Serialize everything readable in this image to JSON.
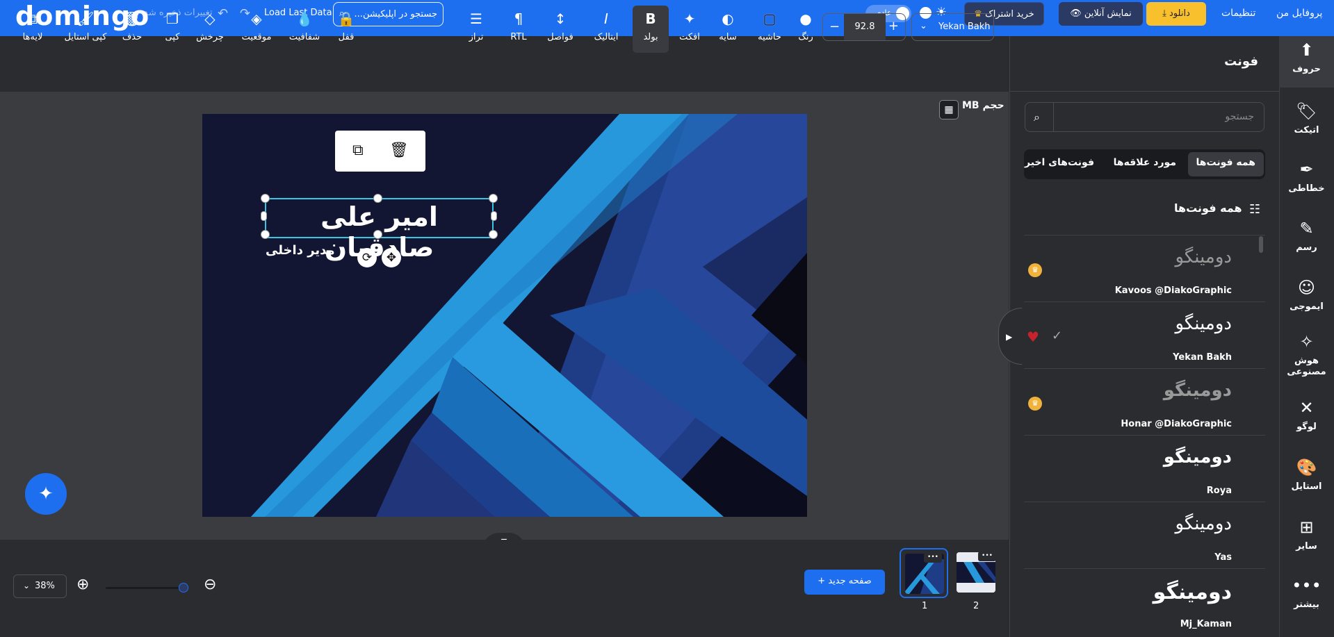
{
  "topbar": {
    "logo": "domingo",
    "saved_status": "تغییرات ذخیره شد",
    "load_last": "Load Last Data",
    "search_placeholder": "جستجو در اپلیکیشن...",
    "theme_mode": "عادی",
    "subscribe_label": "خرید اشتراک",
    "live_label": "نمایش آنلاین",
    "download_label": "دانلود",
    "settings_label": "تنظیمات",
    "profile_label": "پروفایل من",
    "brand_color": "#1e6ff0",
    "download_color": "#f8c02c"
  },
  "toolbar": {
    "font_family": "Yekan Bakh",
    "font_size": "92.8",
    "tools": [
      {
        "label": "لایه‌ها",
        "icon": "layers-icon"
      },
      {
        "label": "کپی استایل",
        "icon": "brush-icon"
      },
      {
        "label": "حذف",
        "icon": "trash-icon"
      },
      {
        "label": "کپی",
        "icon": "copy-icon"
      },
      {
        "label": "چرخش",
        "icon": "rotate-icon"
      },
      {
        "label": "موقعیت",
        "icon": "position-icon"
      },
      {
        "label": "شفافیت",
        "icon": "opacity-icon"
      },
      {
        "label": "قفل",
        "icon": "lock-icon"
      },
      {
        "label": "تراز",
        "icon": "align-icon"
      },
      {
        "label": "RTL",
        "icon": "rtl-icon"
      },
      {
        "label": "فواصل",
        "icon": "spacing-icon"
      },
      {
        "label": "ایتالیک",
        "icon": "italic-icon"
      },
      {
        "label": "بولد",
        "icon": "bold-icon"
      },
      {
        "label": "افکت",
        "icon": "effect-icon"
      },
      {
        "label": "سایه",
        "icon": "shadow-icon"
      },
      {
        "label": "حاشیه",
        "icon": "border-icon"
      },
      {
        "label": "رنگ",
        "icon": "color-icon"
      }
    ]
  },
  "canvas": {
    "file_size_label": "حجم MB",
    "title_text": "امیر علی صادقیان",
    "subtitle_text": "مدیر داخلی",
    "selection_color": "#39c6e0"
  },
  "bottom": {
    "zoom": "38%",
    "new_page": "صفحه جدید",
    "pages": [
      "1",
      "2"
    ]
  },
  "font_panel": {
    "title": "فونت",
    "search_placeholder": "جستجو",
    "tabs": [
      "همه فونت‌ها",
      "مورد علاقه‌ها",
      "فونت‌های اخیر"
    ],
    "section_title": "همه فونت‌ها",
    "fonts": [
      {
        "sample": "دومینگو",
        "name": "Kavoos @DiakoGraphic",
        "premium": true,
        "favorite": false,
        "selected": false
      },
      {
        "sample": "دومینگو",
        "name": "Yekan Bakh",
        "premium": false,
        "favorite": true,
        "selected": true
      },
      {
        "sample": "دومینگو",
        "name": "Honar @DiakoGraphic",
        "premium": true,
        "favorite": false,
        "selected": false
      },
      {
        "sample": "دومینگو",
        "name": "Roya",
        "premium": false,
        "favorite": false,
        "selected": false
      },
      {
        "sample": "دومینگو",
        "name": "Yas",
        "premium": false,
        "favorite": false,
        "selected": false
      },
      {
        "sample": "دومینگو",
        "name": "Mj_Kaman",
        "premium": false,
        "favorite": false,
        "selected": false
      }
    ]
  },
  "rail": {
    "items": [
      {
        "label": "حروف",
        "icon": "text-icon"
      },
      {
        "label": "اتیکت",
        "icon": "tag-icon"
      },
      {
        "label": "خطاطی",
        "icon": "feather-icon"
      },
      {
        "label": "رسم",
        "icon": "pencil-icon"
      },
      {
        "label": "ایموجی",
        "icon": "emoji-icon"
      },
      {
        "label": "هوش مصنوعی",
        "icon": "magic-wand-icon"
      },
      {
        "label": "لوگو",
        "icon": "logo-shapes-icon"
      },
      {
        "label": "استایل",
        "icon": "palette-icon"
      },
      {
        "label": "سایر",
        "icon": "grid-plus-icon"
      },
      {
        "label": "بیشتر",
        "icon": "more-icon"
      }
    ]
  }
}
